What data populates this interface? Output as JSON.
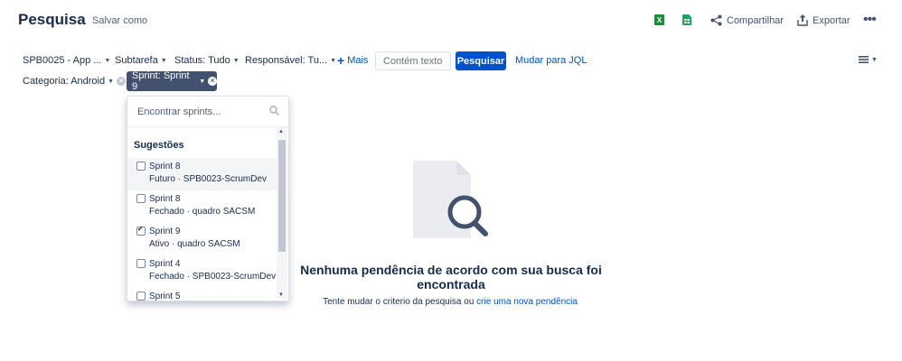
{
  "header": {
    "title": "Pesquisa",
    "save_as": "Salvar como",
    "share_label": "Compartilhar",
    "export_label": "Exportar"
  },
  "filters": {
    "project": "SPB0025 - App ...",
    "type": "Subtarefa",
    "status": "Status: Tudo",
    "assignee": "Responsável: Tu...",
    "more": "Mais",
    "text_placeholder": "Contém texto",
    "search_button": "Pesquisar",
    "jql_link": "Mudar para JQL",
    "category": "Categoria: Android",
    "sprint": "Sprint: Sprint 9"
  },
  "sprint_dropdown": {
    "search_placeholder": "Encontrar sprints...",
    "heading": "Sugestões",
    "items": [
      {
        "name": "Sprint 8",
        "desc": "Futuro · SPB0023-ScrumDev",
        "checked": false
      },
      {
        "name": "Sprint 8",
        "desc": "Fechado · quadro SACSM",
        "checked": false
      },
      {
        "name": "Sprint 9",
        "desc": "Ativo · quadro SACSM",
        "checked": true
      },
      {
        "name": "Sprint 4",
        "desc": "Fechado · SPB0023-ScrumDev",
        "checked": false
      },
      {
        "name": "Sprint 5",
        "desc": "",
        "checked": false
      }
    ]
  },
  "empty_state": {
    "title": "Nenhuma pendência de acordo com sua busca foi encontrada",
    "subtitle_prefix": "Tente mudar o criterio da pesquisa ou ",
    "subtitle_link": "crie uma nova pendência"
  },
  "colors": {
    "primary": "#0052cc",
    "chip": "#42526e",
    "excel_green": "#1d8a3c"
  },
  "icons": [
    "excel-icon",
    "sheets-icon",
    "share-icon",
    "export-icon",
    "more-icon",
    "search-icon",
    "layout-menu-icon",
    "magnifier-document-icon"
  ]
}
